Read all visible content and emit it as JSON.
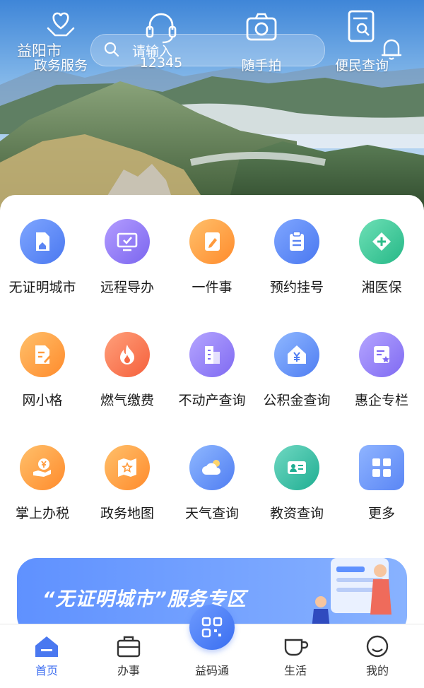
{
  "header": {
    "city": "益阳市",
    "search_placeholder": "请输入",
    "top_items": [
      {
        "label": "政务服务",
        "icon": "heart-hand-icon"
      },
      {
        "label": "12345",
        "icon": "headset-icon"
      },
      {
        "label": "随手拍",
        "icon": "camera-icon"
      },
      {
        "label": "便民查询",
        "icon": "document-search-icon"
      }
    ]
  },
  "services": [
    {
      "label": "无证明城市",
      "icon": "document-home-icon",
      "color": "#4a78f0"
    },
    {
      "label": "远程导办",
      "icon": "monitor-check-icon",
      "color": "#7b66ef"
    },
    {
      "label": "一件事",
      "icon": "notebook-pen-icon",
      "color": "#ff8b2c"
    },
    {
      "label": "预约挂号",
      "icon": "clipboard-icon",
      "color": "#4a78f0"
    },
    {
      "label": "湘医保",
      "icon": "medical-cross-icon",
      "color": "#26b887"
    },
    {
      "label": "网小格",
      "icon": "doc-edit-icon",
      "color": "#ff8b2c"
    },
    {
      "label": "燃气缴费",
      "icon": "flame-icon",
      "color": "#f5603c"
    },
    {
      "label": "不动产查询",
      "icon": "building-icon",
      "color": "#7f6af2"
    },
    {
      "label": "公积金查询",
      "icon": "house-yen-icon",
      "color": "#4f7df2"
    },
    {
      "label": "惠企专栏",
      "icon": "card-star-icon",
      "color": "#7f6af2"
    },
    {
      "label": "掌上办税",
      "icon": "hand-coin-icon",
      "color": "#ff8b2c"
    },
    {
      "label": "政务地图",
      "icon": "map-star-icon",
      "color": "#ff8b2c"
    },
    {
      "label": "天气查询",
      "icon": "weather-icon",
      "color": "#4f7df2"
    },
    {
      "label": "教资查询",
      "icon": "id-card-icon",
      "color": "#1fae92"
    },
    {
      "label": "更多",
      "icon": "grid-more-icon",
      "color": "#5a86f5"
    }
  ],
  "banner": {
    "text": "“无证明城市”服务专区"
  },
  "tabbar": {
    "items": [
      {
        "label": "首页",
        "icon": "home-icon",
        "active": true
      },
      {
        "label": "办事",
        "icon": "briefcase-icon",
        "active": false
      },
      {
        "label": "益码通",
        "icon": "qr-code-icon",
        "active": false
      },
      {
        "label": "生活",
        "icon": "cup-icon",
        "active": false
      },
      {
        "label": "我的",
        "icon": "user-face-icon",
        "active": false
      }
    ],
    "active_color": "#3c6df0"
  }
}
